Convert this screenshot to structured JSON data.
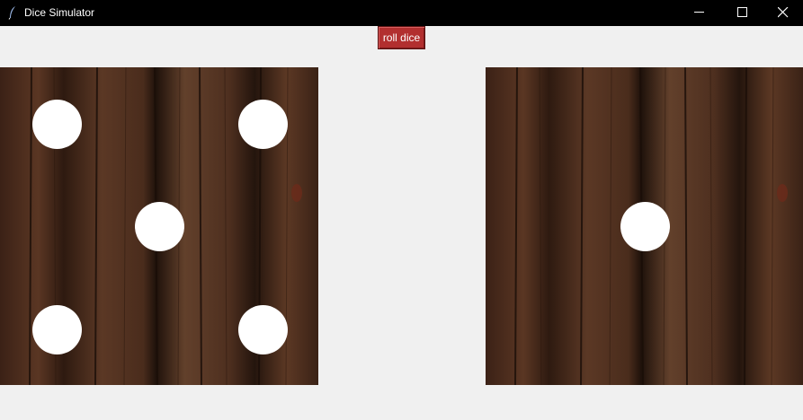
{
  "window": {
    "title": "Dice Simulator",
    "app_icon": "feather-icon",
    "controls": [
      "minimize-icon",
      "maximize-icon",
      "close-icon"
    ]
  },
  "toolbar": {
    "roll_label": "roll dice",
    "roll_color": "#b22f2f"
  },
  "dice": [
    {
      "name": "left-die",
      "value": 5
    },
    {
      "name": "right-die",
      "value": 1
    }
  ],
  "colors": {
    "titlebar": "#000000",
    "background": "#f0f0f0",
    "wood": "#4a2c1c",
    "pip": "#ffffff"
  }
}
